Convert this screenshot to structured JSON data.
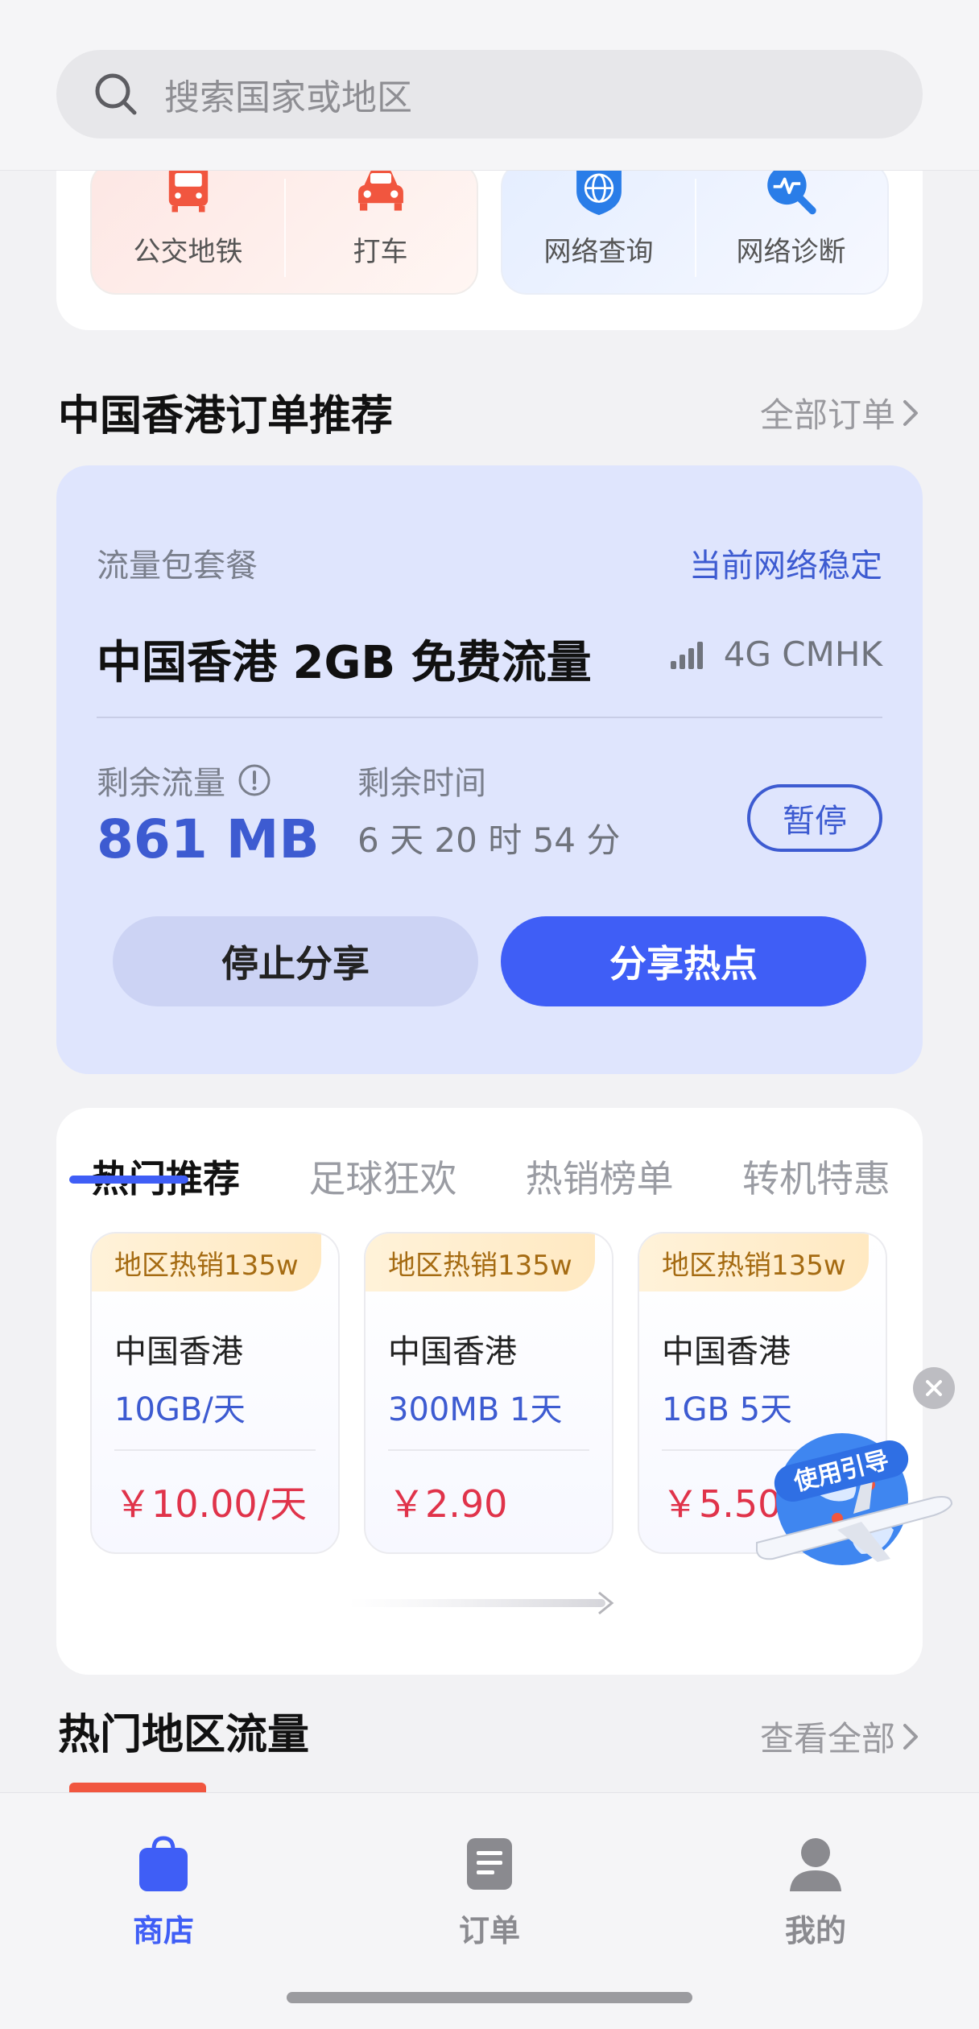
{
  "search": {
    "placeholder": "搜索国家或地区"
  },
  "services": [
    {
      "label": "公交地铁",
      "icon": "bus-icon"
    },
    {
      "label": "打车",
      "icon": "car-icon"
    },
    {
      "label": "网络查询",
      "icon": "globe-shield-icon"
    },
    {
      "label": "网络诊断",
      "icon": "network-diagnose-icon"
    }
  ],
  "orders": {
    "title": "中国香港订单推荐",
    "more": "全部订单",
    "card": {
      "subtitle": "流量包套餐",
      "status": "当前网络稳定",
      "title": "中国香港 2GB 免费流量",
      "network": "4G CMHK",
      "remaining_data_label": "剩余流量",
      "remaining_data_value": "861 MB",
      "remaining_time_label": "剩余时间",
      "remaining_time_value": "6 天 20 时 54 分",
      "pause_label": "暂停",
      "stop_share_label": "停止分享",
      "share_hotspot_label": "分享热点"
    }
  },
  "recommend": {
    "tabs": [
      "热门推荐",
      "足球狂欢",
      "热销榜单",
      "转机特惠"
    ],
    "active_tab": 0,
    "products": [
      {
        "badge": "地区热销135w",
        "region": "中国香港",
        "package": "10GB/天",
        "price": "￥10.00/天"
      },
      {
        "badge": "地区热销135w",
        "region": "中国香港",
        "package": "300MB 1天",
        "price": "￥2.90"
      },
      {
        "badge": "地区热销135w",
        "region": "中国香港",
        "package": "1GB 5天",
        "price": "￥5.50"
      }
    ]
  },
  "hot_regions": {
    "title": "热门地区流量",
    "more": "查看全部"
  },
  "guide": {
    "label": "使用引导"
  },
  "nav": [
    {
      "label": "商店",
      "icon": "shopping-bag-icon",
      "active": true
    },
    {
      "label": "订单",
      "icon": "order-doc-icon",
      "active": false
    },
    {
      "label": "我的",
      "icon": "person-icon",
      "active": false
    }
  ],
  "colors": {
    "accent": "#3f5ef6",
    "price": "#e0334a",
    "badge": "#a56b12",
    "order_card_bg": "#dfe5fd"
  }
}
